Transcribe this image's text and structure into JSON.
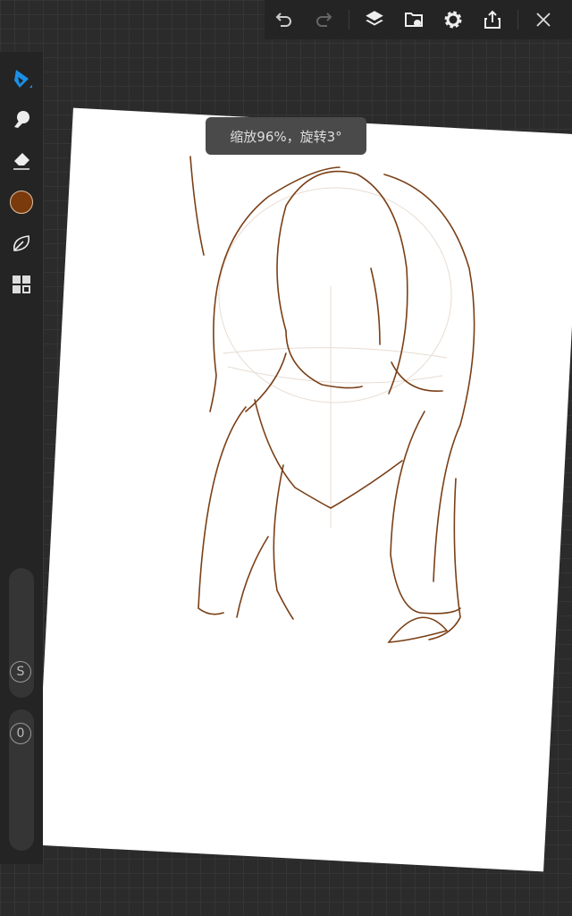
{
  "toolbar": {
    "icons": [
      "undo-icon",
      "redo-icon",
      "layers-icon",
      "gallery-icon",
      "settings-icon",
      "share-icon",
      "close-icon"
    ]
  },
  "sidebar": {
    "tools": [
      "brush",
      "smudge",
      "eraser",
      "color",
      "leaf",
      "grid"
    ],
    "color": "#7a3a0c",
    "accent": "#1a8fe8",
    "size_label": "S",
    "opacity_label": "0"
  },
  "toast": {
    "text": "缩放96%，旋转3°"
  },
  "stroke_color": "#7a3f16"
}
